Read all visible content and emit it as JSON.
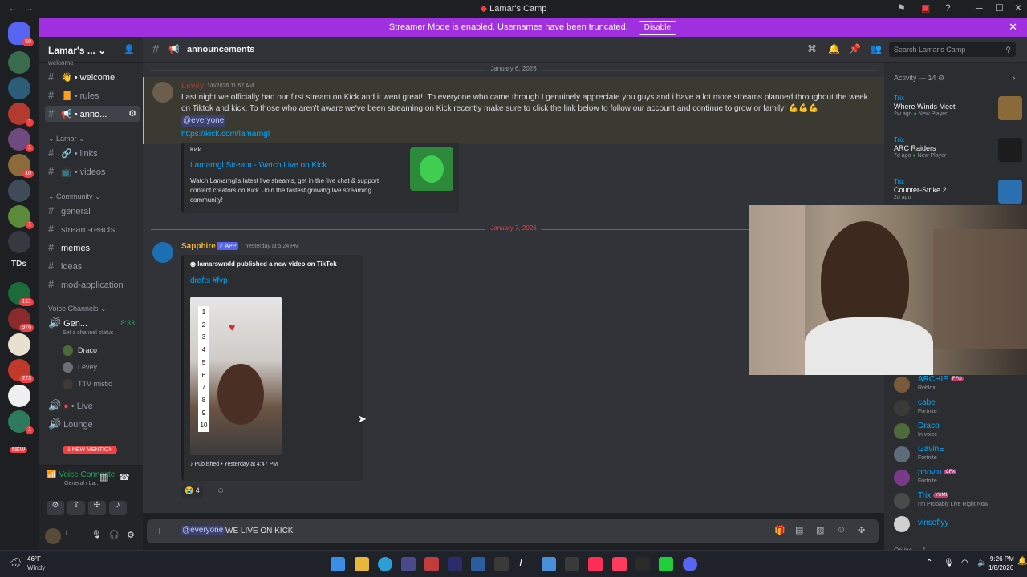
{
  "window": {
    "title": "Lamar's Camp"
  },
  "banner": {
    "text": "Streamer Mode is enabled. Usernames have been truncated.",
    "button": "Disable"
  },
  "rail": {
    "badge_top": "50",
    "badges": [
      "1",
      "1",
      "10",
      "1",
      "1",
      "161",
      "976",
      "223",
      "1"
    ],
    "tds": "TDs",
    "new_label": "NEW"
  },
  "server": {
    "name": "Lamar's ...",
    "partial_top": "welcome"
  },
  "channels": [
    {
      "name": "welcome",
      "emoji": "👋"
    },
    {
      "name": "rules",
      "emoji": "📙"
    },
    {
      "name": "anno...",
      "emoji": "📢"
    }
  ],
  "categories": {
    "lamar": "Lamar",
    "community": "Community",
    "voice": "Voice Channels"
  },
  "lamar_channels": [
    {
      "name": "links",
      "emoji": "🔗"
    },
    {
      "name": "videos",
      "emoji": "📺"
    }
  ],
  "community_channels": [
    "general",
    "stream-reacts",
    "memes",
    "ideas",
    "mod-application"
  ],
  "voice": {
    "channel": "Gen...",
    "time": "8:33",
    "status_hint": "Set a channel status",
    "users": [
      "Draco",
      "Levey",
      "TTV mistic"
    ],
    "live": "Live",
    "lounge": "Lounge",
    "mention_pill": "1 NEW MENTION"
  },
  "voice_panel": {
    "status": "Voice Connecte",
    "sub": "General / La..."
  },
  "user_panel": {
    "name": "L..."
  },
  "chat": {
    "channel": "announcements",
    "search_placeholder": "Search Lamar's Camp"
  },
  "messages": {
    "date1": "January 6, 2026",
    "m1": {
      "author": "Levey",
      "time": "1/6/2026 11:57 AM",
      "text": "Last night we officially had our first stream on Kick and it went great!! To everyone who came through I genuinely appreciate you guys and i have a lot more streams planned throughout the week on Tiktok and kick. To those who aren't aware we've been streaming on Kick recently make sure to click the link below to follow our account and continue to grow or family! 💪💪💪",
      "mention": "@everyone",
      "link": "https://kick.com/lamarngl"
    },
    "embed1": {
      "provider": "Kick",
      "title": "Lamarngl Stream - Watch Live on Kick",
      "desc": "Watch Lamarngl's latest live streams, get in the live chat & support content creators on Kick. Join the fastest growing live streaming community!"
    },
    "date2": "January 7, 2026",
    "m2": {
      "author": "Sapphire",
      "badge": "✓ APP",
      "time": "Yesterday at 5:24 PM"
    },
    "embed2": {
      "author": "lamarswrxld published a new video on TikTok",
      "title": "drafts #fyp",
      "footer": "Published • Yesterday at 4:47 PM",
      "numbers": [
        "1",
        "2",
        "3",
        "4",
        "5",
        "6",
        "7",
        "8",
        "9",
        "10"
      ]
    },
    "reaction": {
      "emoji": "😭",
      "count": "4"
    }
  },
  "composer": {
    "mention": "@everyone",
    "text": "WE LIVE ON KICK"
  },
  "activity": {
    "header": "Activity — 14",
    "items": [
      {
        "who": "Trix",
        "game": "Where Winds Meet",
        "meta": "2w ago",
        "tag": "New Player"
      },
      {
        "who": "Trix",
        "game": "ARC Raiders",
        "meta": "7d ago",
        "tag": "New Player"
      },
      {
        "who": "Trix",
        "game": "Counter-Strike 2",
        "meta": "2d ago",
        "tag": ""
      }
    ]
  },
  "members": [
    {
      "name": "ARCHIE",
      "tag": "FFO",
      "status": "Roblox",
      "color": "#00a8fc"
    },
    {
      "name": "cabe",
      "tag": "",
      "status": "Fortnite",
      "color": "#00a8fc"
    },
    {
      "name": "Draco",
      "tag": "",
      "status": "In voice",
      "color": "#00a8fc"
    },
    {
      "name": "GavinE",
      "tag": "",
      "status": "Fortnite",
      "color": "#00a8fc"
    },
    {
      "name": "phovin",
      "tag": "CFX",
      "status": "Fortnite",
      "color": "#00a8fc"
    },
    {
      "name": "Trix",
      "tag": "YUMI",
      "status": "I'm Probably Live Right Now",
      "color": "#00a8fc"
    },
    {
      "name": "vinsoflyy",
      "tag": "",
      "status": "",
      "color": "#00a8fc"
    }
  ],
  "members_footer": "Online — 1",
  "taskbar": {
    "temp": "46°F",
    "weather": "Windy",
    "time": "9:26 PM",
    "date": "1/8/2026"
  },
  "colors": {
    "banner": "#a02fe0",
    "accent": "#5865f2",
    "link": "#00a8fc",
    "bg": "#313338"
  }
}
